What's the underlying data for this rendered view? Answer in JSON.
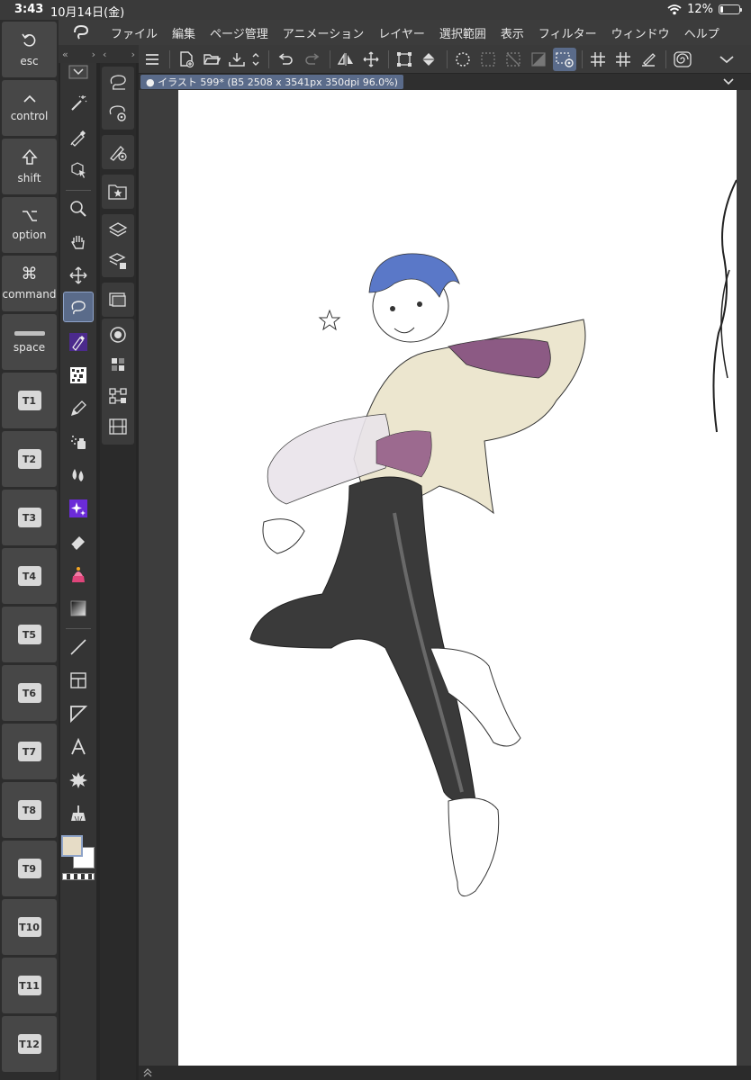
{
  "status": {
    "time": "3:43",
    "date": "10月14日(金)",
    "battery": "12%",
    "battery_level": 0.12
  },
  "modifier_keys": [
    {
      "label": "esc",
      "icon": "undo-arrow-icon"
    },
    {
      "label": "control",
      "icon": "caret-up-icon"
    },
    {
      "label": "shift",
      "icon": "shift-arrow-icon"
    },
    {
      "label": "option",
      "icon": "option-key-icon"
    },
    {
      "label": "command",
      "icon": "command-key-icon"
    },
    {
      "label": "space",
      "icon": "space-bar-icon"
    },
    {
      "label": "T1"
    },
    {
      "label": "T2"
    },
    {
      "label": "T3"
    },
    {
      "label": "T4"
    },
    {
      "label": "T5"
    },
    {
      "label": "T6"
    },
    {
      "label": "T7"
    },
    {
      "label": "T8"
    },
    {
      "label": "T9"
    },
    {
      "label": "T10"
    },
    {
      "label": "T11"
    },
    {
      "label": "T12"
    }
  ],
  "menu": {
    "items": [
      "ファイル",
      "編集",
      "ページ管理",
      "アニメーション",
      "レイヤー",
      "選択範囲",
      "表示",
      "フィルター",
      "ウィンドウ",
      "ヘルプ"
    ]
  },
  "document": {
    "tab_label": "● イラスト 599* (B5 2508 x 3541px 350dpi 96.0%)"
  },
  "colors": {
    "main": "#e6dcc6",
    "sub": "#ffffff",
    "accent": "#5a6b8a"
  },
  "tools": [
    "magic-wand-icon",
    "eyedropper-icon",
    "object-select-icon",
    "zoom-icon",
    "hand-icon",
    "move-icon",
    "lasso-icon",
    "pen-icon",
    "decoration-icon",
    "pencil-icon",
    "airbrush-icon",
    "blend-icon",
    "sparkle-icon",
    "eraser-icon",
    "fill-icon",
    "gradient-icon",
    "line-icon",
    "frame-icon",
    "ruler-icon",
    "text-icon",
    "balloon-icon",
    "correction-icon"
  ]
}
